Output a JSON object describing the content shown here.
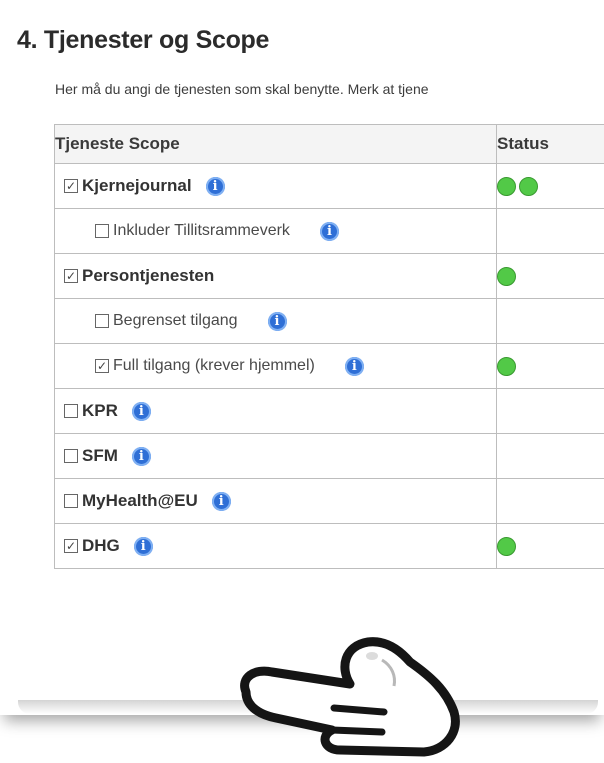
{
  "section": {
    "title": "4. Tjenester og Scope",
    "description": "Her må du angi de tjenesten som skal benytte. Merk at tjene"
  },
  "table": {
    "headers": {
      "scope": "Tjeneste Scope",
      "status": "Status"
    },
    "rows": [
      {
        "label": "Kjernejournal",
        "level": 1,
        "checked": true,
        "info": true,
        "status_dots": 2
      },
      {
        "label": "Inkluder Tillitsrammeverk",
        "level": 2,
        "checked": false,
        "info": true,
        "status_dots": 0
      },
      {
        "label": "Persontjenesten",
        "level": 1,
        "checked": true,
        "info": false,
        "status_dots": 1
      },
      {
        "label": "Begrenset tilgang",
        "level": 2,
        "checked": false,
        "info": true,
        "status_dots": 0
      },
      {
        "label": "Full tilgang (krever hjemmel)",
        "level": 2,
        "checked": true,
        "info": true,
        "status_dots": 1
      },
      {
        "label": "KPR",
        "level": 1,
        "checked": false,
        "info": true,
        "status_dots": 0
      },
      {
        "label": "SFM",
        "level": 1,
        "checked": false,
        "info": true,
        "status_dots": 0
      },
      {
        "label": "MyHealth@EU",
        "level": 1,
        "checked": false,
        "info": true,
        "status_dots": 0
      },
      {
        "label": "DHG",
        "level": 1,
        "checked": true,
        "info": true,
        "status_dots": 1
      }
    ]
  },
  "colors": {
    "status_ok": "#52c947",
    "info_icon": "#2f6fd6"
  },
  "icons": {
    "info": "info-icon",
    "status": "status-ok-icon",
    "checkbox": "checkbox-icon",
    "cursor": "pointing-hand-icon"
  },
  "glyphs": {
    "check": "✓",
    "info": "i"
  }
}
